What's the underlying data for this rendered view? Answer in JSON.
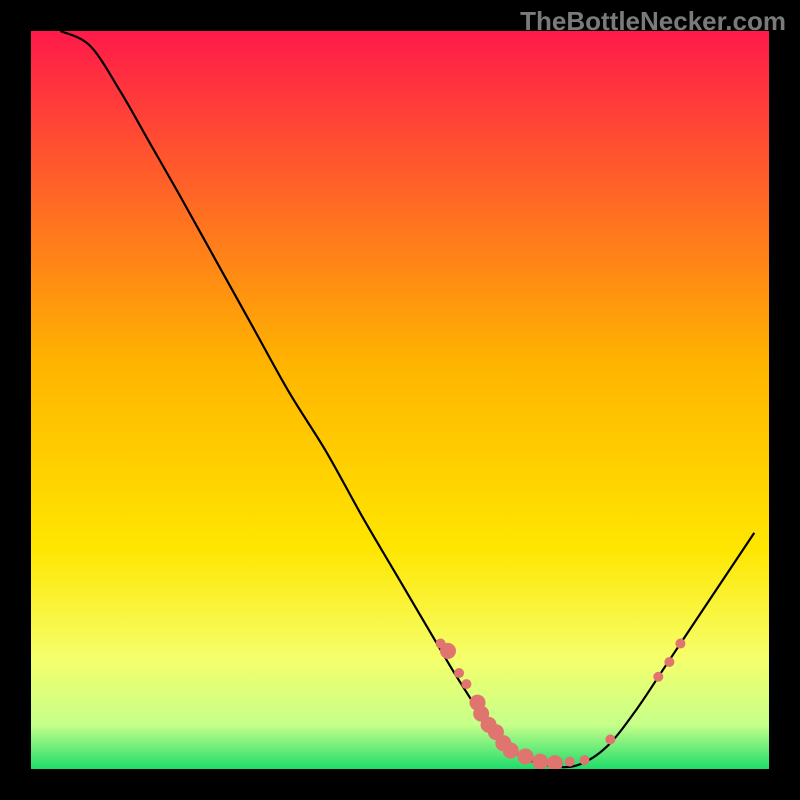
{
  "watermark": "TheBottleNecker.com",
  "chart_data": {
    "type": "line",
    "title": "",
    "xlabel": "",
    "ylabel": "",
    "xlim": [
      0,
      100
    ],
    "ylim": [
      0,
      100
    ],
    "grid": false,
    "legend": false,
    "gradient_stops": [
      {
        "offset": 0,
        "color": "#ff1a4a"
      },
      {
        "offset": 0.45,
        "color": "#ffb400"
      },
      {
        "offset": 0.7,
        "color": "#ffe600"
      },
      {
        "offset": 0.85,
        "color": "#f5ff6b"
      },
      {
        "offset": 0.94,
        "color": "#c6ff8a"
      },
      {
        "offset": 1.0,
        "color": "#1fdc6b"
      }
    ],
    "curve": [
      {
        "x": 4,
        "y": 100
      },
      {
        "x": 8,
        "y": 98
      },
      {
        "x": 12,
        "y": 92
      },
      {
        "x": 16,
        "y": 85
      },
      {
        "x": 20,
        "y": 78
      },
      {
        "x": 25,
        "y": 69
      },
      {
        "x": 30,
        "y": 60
      },
      {
        "x": 35,
        "y": 51
      },
      {
        "x": 40,
        "y": 43
      },
      {
        "x": 45,
        "y": 34
      },
      {
        "x": 50,
        "y": 25.5
      },
      {
        "x": 55,
        "y": 17
      },
      {
        "x": 58,
        "y": 12
      },
      {
        "x": 62,
        "y": 6
      },
      {
        "x": 66,
        "y": 2
      },
      {
        "x": 70,
        "y": 0.5
      },
      {
        "x": 74,
        "y": 0.5
      },
      {
        "x": 78,
        "y": 3
      },
      {
        "x": 82,
        "y": 8
      },
      {
        "x": 86,
        "y": 14
      },
      {
        "x": 90,
        "y": 20
      },
      {
        "x": 94,
        "y": 26
      },
      {
        "x": 98,
        "y": 32
      }
    ],
    "markers": [
      {
        "x": 55.5,
        "y": 17,
        "r": 5
      },
      {
        "x": 56.5,
        "y": 16,
        "r": 8
      },
      {
        "x": 58,
        "y": 13,
        "r": 5
      },
      {
        "x": 59,
        "y": 11.5,
        "r": 5
      },
      {
        "x": 60.5,
        "y": 9,
        "r": 8
      },
      {
        "x": 61,
        "y": 7.5,
        "r": 8
      },
      {
        "x": 62,
        "y": 6,
        "r": 8
      },
      {
        "x": 63,
        "y": 5,
        "r": 8
      },
      {
        "x": 64,
        "y": 3.5,
        "r": 8
      },
      {
        "x": 65,
        "y": 2.5,
        "r": 8
      },
      {
        "x": 67,
        "y": 1.7,
        "r": 8
      },
      {
        "x": 69,
        "y": 1.0,
        "r": 8
      },
      {
        "x": 71,
        "y": 0.8,
        "r": 8
      },
      {
        "x": 73,
        "y": 1.0,
        "r": 5
      },
      {
        "x": 75,
        "y": 1.2,
        "r": 5
      },
      {
        "x": 78.5,
        "y": 4,
        "r": 5
      },
      {
        "x": 85,
        "y": 12.5,
        "r": 5
      },
      {
        "x": 86.5,
        "y": 14.5,
        "r": 5
      },
      {
        "x": 88,
        "y": 17,
        "r": 5
      }
    ],
    "marker_color": "#e0746e",
    "curve_color": "#000000"
  }
}
